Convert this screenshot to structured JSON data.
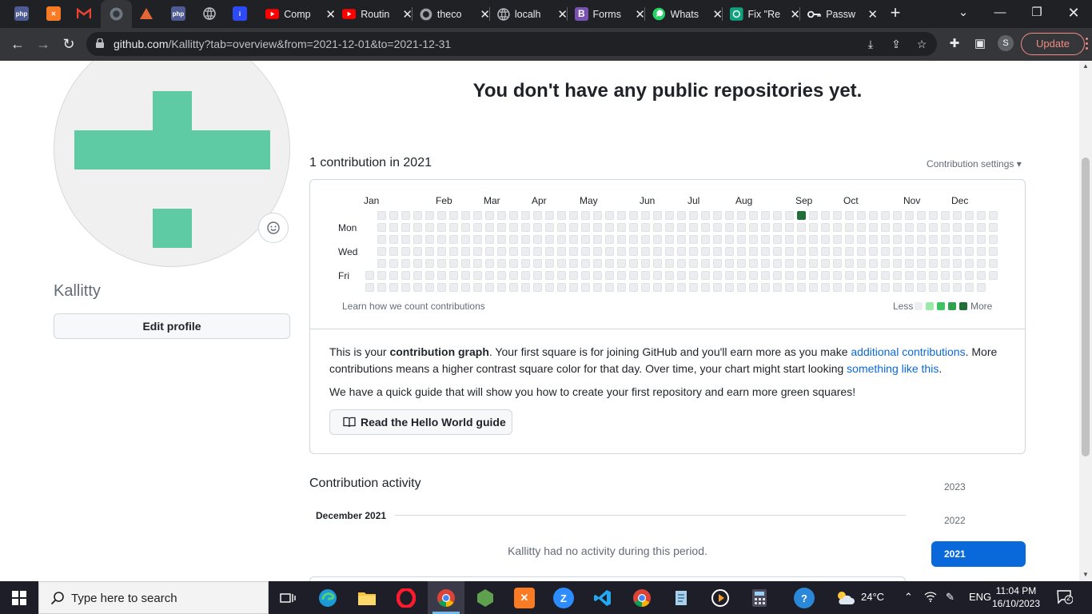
{
  "browser": {
    "tabs": [
      {
        "title": "Comp"
      },
      {
        "title": "Routin"
      },
      {
        "title": "theco"
      },
      {
        "title": "localh"
      },
      {
        "title": "Forms"
      },
      {
        "title": "Whats"
      },
      {
        "title": "Fix \"Re"
      },
      {
        "title": "Passw"
      }
    ],
    "pinned_labels": [
      "php",
      "php"
    ],
    "url_host": "github.com",
    "url_path": "/Kallitty?tab=overview&from=2021-12-01&to=2021-12-31",
    "profile_initial": "S",
    "update_label": "Update"
  },
  "profile": {
    "username": "Kallitty",
    "edit_label": "Edit profile",
    "identicon_color": "#5fcba5"
  },
  "main": {
    "no_repos": "You don't have any public repositories yet.",
    "contrib_count": "1 contribution in 2021",
    "contrib_settings": "Contribution settings ▾"
  },
  "graph": {
    "months": [
      "Jan",
      "Feb",
      "Mar",
      "Apr",
      "May",
      "Jun",
      "Jul",
      "Aug",
      "Sep",
      "Oct",
      "Nov",
      "Dec"
    ],
    "day_labels": [
      "Mon",
      "Wed",
      "Fri"
    ],
    "learn_link": "Learn how we count contributions",
    "legend_less": "Less",
    "legend_more": "More",
    "contribution_day": "Sep, week 36, Sunday",
    "colors": {
      "empty": "#ebedf0",
      "l1": "#9be9a8",
      "l2": "#40c463",
      "l3": "#30a14e",
      "l4": "#216e39"
    }
  },
  "info": {
    "p1_start": "This is your ",
    "p1_bold": "contribution graph",
    "p1_mid": ". Your first square is for joining GitHub and you'll earn more as you make ",
    "p1_link1": "additional contributions",
    "p1_mid2": ". More contributions means a higher contrast square color for that day. Over time, your chart might start looking ",
    "p1_link2": "something like this",
    "p1_end": ".",
    "p2": "We have a quick guide that will show you how to create your first repository and earn more green squares!",
    "hello_label": "Read the Hello World guide"
  },
  "activity": {
    "title": "Contribution activity",
    "month_heading": "December 2021",
    "empty_text": "Kallitty had no activity during this period.",
    "years": [
      {
        "label": "2023",
        "selected": false
      },
      {
        "label": "2022",
        "selected": false
      },
      {
        "label": "2021",
        "selected": true
      }
    ]
  },
  "taskbar": {
    "search_placeholder": "Type here to search",
    "weather": "24°C",
    "language": "ENG",
    "time": "11:04 PM",
    "date": "16/10/2023",
    "notification_count": "2"
  }
}
